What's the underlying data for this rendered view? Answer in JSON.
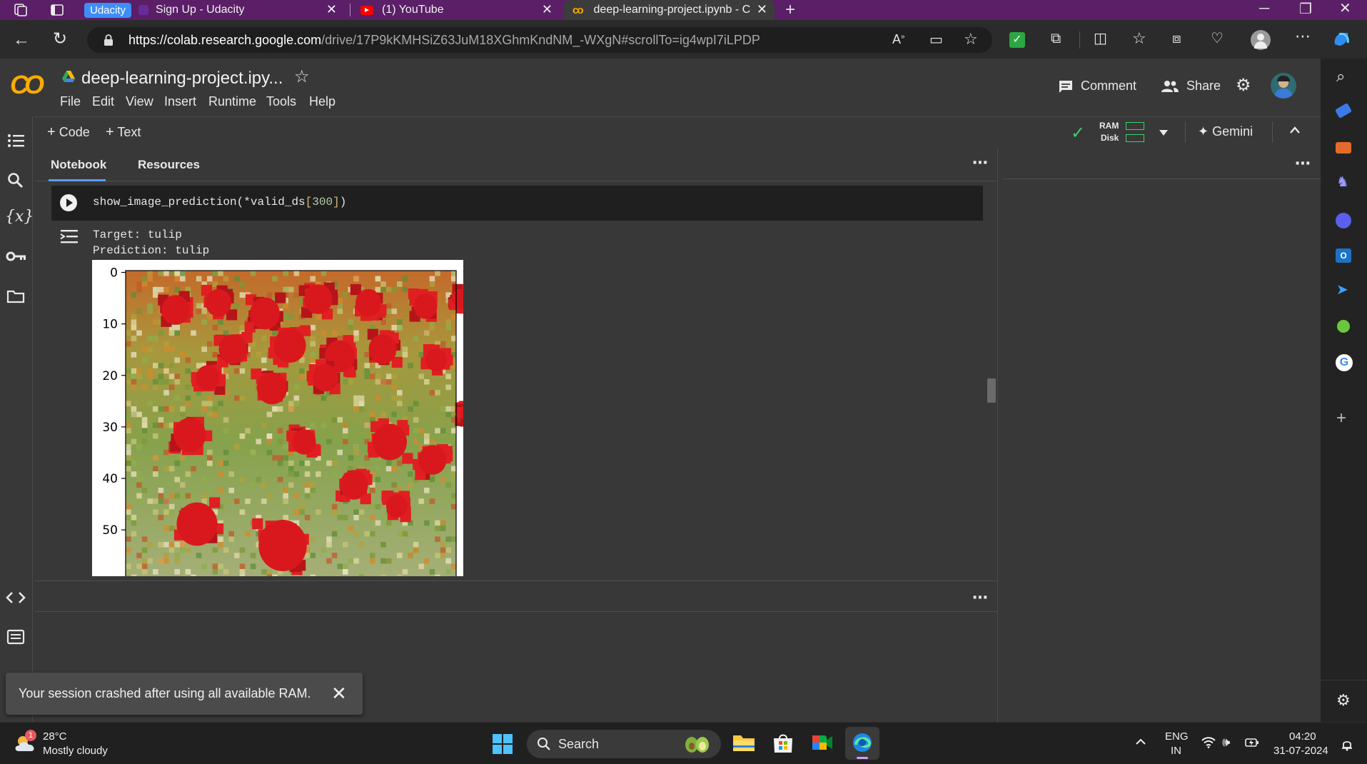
{
  "browser": {
    "tabs": [
      {
        "badge": "Udacity",
        "label": "Sign Up - Udacity"
      },
      {
        "label": "(1) YouTube"
      },
      {
        "label": "deep-learning-project.ipynb - Co"
      }
    ],
    "url_host": "https://colab.research.google.com",
    "url_path": "/drive/17P9kKMHSiZ63JuM18XGhmKndNM_-WXgN#scrollTo=ig4wpI7iLPDP"
  },
  "colab": {
    "logo": "CO",
    "title": "deep-learning-project.ipy...",
    "menu": [
      "File",
      "Edit",
      "View",
      "Insert",
      "Runtime",
      "Tools",
      "Help"
    ],
    "comment_label": "Comment",
    "share_label": "Share",
    "toolbar": {
      "code_label": "Code",
      "text_label": "Text",
      "ram_label": "RAM",
      "disk_label": "Disk",
      "gemini_label": "Gemini"
    },
    "panel_tabs": [
      "Notebook",
      "Resources"
    ]
  },
  "cell": {
    "code_fn": "show_image_prediction(*valid_ds",
    "code_open": "[",
    "code_index": "300",
    "code_close": "]",
    "code_end": ")",
    "output_target": "Target: tulip",
    "output_prediction": "Prediction: tulip"
  },
  "plot": {
    "y_ticks": [
      "0",
      "10",
      "20",
      "30",
      "40",
      "50"
    ]
  },
  "toast": {
    "message": "Your session crashed after using all available RAM."
  },
  "taskbar": {
    "weather_temp": "28°C",
    "weather_desc": "Mostly cloudy",
    "weather_badge": "1",
    "search_label": "Search",
    "lang_top": "ENG",
    "lang_bottom": "IN",
    "time": "04:20",
    "date": "31-07-2024"
  }
}
